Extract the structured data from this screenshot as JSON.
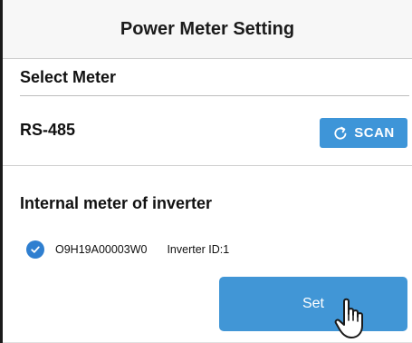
{
  "header": {
    "title": "Power Meter Setting"
  },
  "select_section": {
    "title": "Select Meter"
  },
  "rs485": {
    "label": "RS-485",
    "scan_label": "SCAN"
  },
  "internal_section": {
    "title": "Internal meter of inverter"
  },
  "meter": {
    "serial": "O9H19A00003W0",
    "inverter_id": "Inverter ID:1",
    "checked": true
  },
  "set_button": {
    "label": "Set"
  },
  "colors": {
    "accent": "#3e95d8",
    "check": "#2f7fd0"
  },
  "icons": {
    "scan": "refresh-icon",
    "check": "check-circle-icon",
    "cursor": "hand-pointer-icon"
  }
}
